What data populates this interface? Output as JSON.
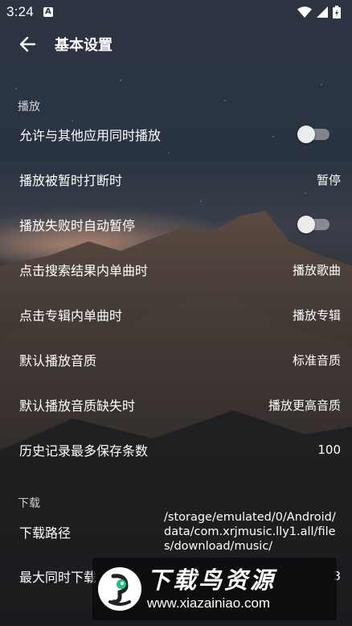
{
  "status_bar": {
    "time": "3:24",
    "notification_glyph": "A",
    "icons": [
      "wifi-icon",
      "signal-icon",
      "battery-icon"
    ]
  },
  "app_bar": {
    "back_icon": "arrow-left-icon",
    "title": "基本设置"
  },
  "sections": {
    "playback": {
      "header": "播放",
      "rows": [
        {
          "label": "允许与其他应用同时播放",
          "type": "switch",
          "checked": false
        },
        {
          "label": "播放被暂时打断时",
          "type": "value",
          "value": "暂停"
        },
        {
          "label": "播放失败时自动暂停",
          "type": "switch",
          "checked": false
        },
        {
          "label": "点击搜索结果内单曲时",
          "type": "value",
          "value": "播放歌曲"
        },
        {
          "label": "点击专辑内单曲时",
          "type": "value",
          "value": "播放专辑"
        },
        {
          "label": "默认播放音质",
          "type": "value",
          "value": "标准音质"
        },
        {
          "label": "默认播放音质缺失时",
          "type": "value",
          "value": "播放更高音质"
        },
        {
          "label": "历史记录最多保存条数",
          "type": "value",
          "value": "100"
        }
      ]
    },
    "download": {
      "header": "下载",
      "rows": [
        {
          "label": "下载路径",
          "type": "value",
          "value": "/storage/emulated/0/Android/data/com.xrjmusic.lly1.all/files/download/music/"
        },
        {
          "label": "最大同时下载",
          "type": "value",
          "value": "3"
        }
      ]
    }
  },
  "watermark": {
    "title": "下载鸟资源",
    "url": "www.xiazainiao.com",
    "logo_icon": "bird-logo-icon"
  },
  "colors": {
    "app_bar": "#2c3442",
    "switch_track_off": "#9a9a9a",
    "switch_thumb_off": "#ececec",
    "watermark_accent": "#1fc28a"
  }
}
